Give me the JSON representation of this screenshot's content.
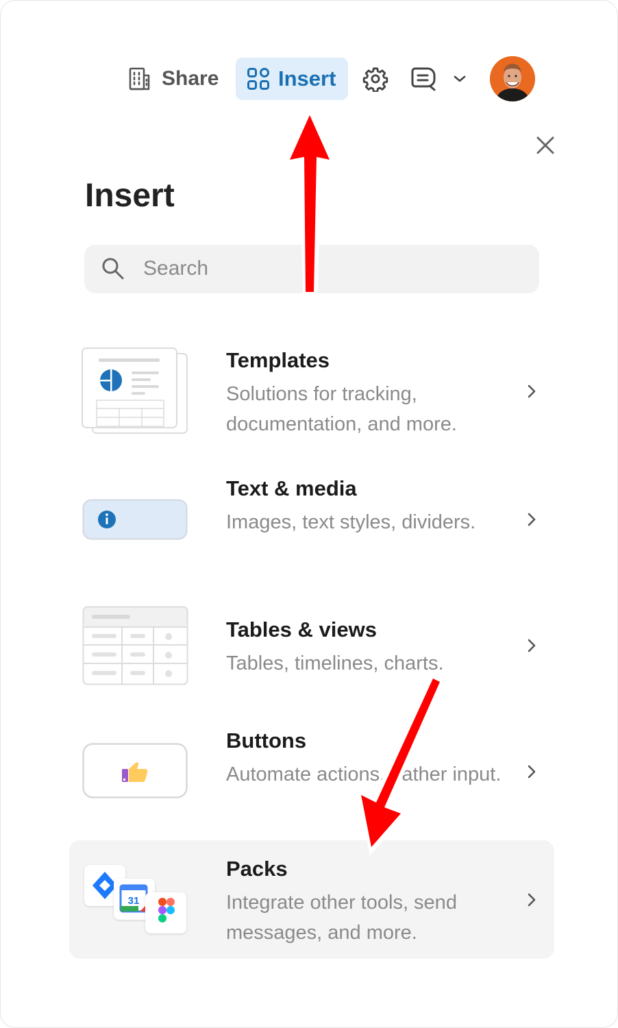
{
  "toolbar": {
    "share_label": "Share",
    "insert_label": "Insert",
    "share_icon": "building-icon",
    "insert_icon": "grid-icon",
    "settings_icon": "gear-icon",
    "comments_icon": "comment-icon",
    "more_icon": "chevron-down-icon"
  },
  "panel": {
    "title": "Insert",
    "search_placeholder": "Search",
    "items": [
      {
        "name": "Templates",
        "description": "Solutions for tracking, documentation, and more."
      },
      {
        "name": "Text & media",
        "description": "Images, text styles, dividers."
      },
      {
        "name": "Tables & views",
        "description": "Tables, timelines, charts."
      },
      {
        "name": "Buttons",
        "description": "Automate actions, gather input."
      },
      {
        "name": "Packs",
        "description": "Integrate other tools, send messages, and more."
      }
    ]
  },
  "calendar_badge": "31",
  "colors": {
    "accent": "#1a6fb3",
    "insert_bg": "#dfeefa",
    "annotation_arrow": "#ff0000"
  }
}
